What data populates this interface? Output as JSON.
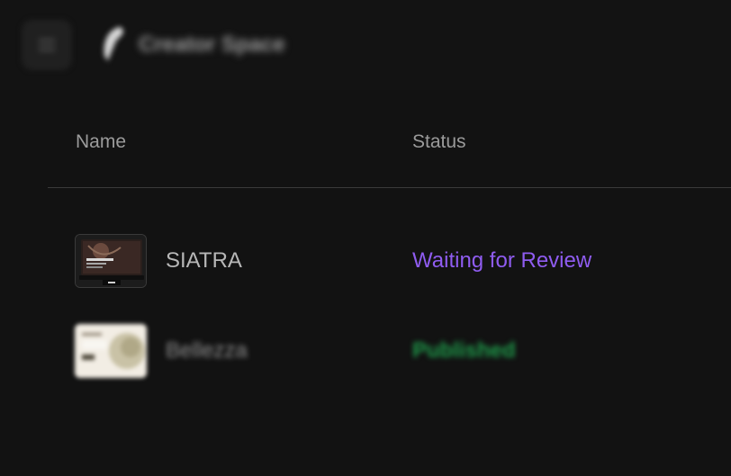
{
  "header": {
    "menu_icon": "menu-icon",
    "logo_icon": "feather-logo-icon",
    "app_name": "Creator Space"
  },
  "table": {
    "columns": [
      "Name",
      "Status"
    ],
    "rows": [
      {
        "name": "SIATRA",
        "status": "Waiting for Review",
        "status_color": "#8f5cf0",
        "thumbnail_icon": "project-thumbnail-icon"
      },
      {
        "name": "Bellezza",
        "status": "Published",
        "status_color": "#1f9a4a",
        "thumbnail_icon": "project-thumbnail-icon"
      }
    ]
  }
}
